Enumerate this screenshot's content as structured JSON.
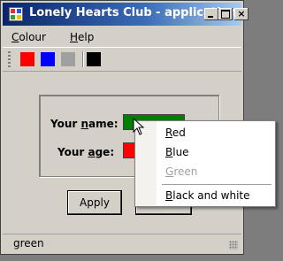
{
  "window": {
    "title": "Lonely Hearts Club - application",
    "buttons": [
      "minimize",
      "maximize",
      "close"
    ]
  },
  "menu": {
    "colour": {
      "first": "C",
      "rest": "olour"
    },
    "help": {
      "first": "H",
      "rest": "elp"
    }
  },
  "toolbar": {
    "swatches": [
      {
        "name": "red",
        "color": "#ff0000"
      },
      {
        "name": "blue",
        "color": "#0000ff"
      },
      {
        "name": "gray",
        "color": "#a0a0a0"
      },
      {
        "name": "black",
        "color": "#000000"
      }
    ]
  },
  "form": {
    "name_label": {
      "pre": "Your ",
      "ul": "n",
      "post": "ame:"
    },
    "age_label": {
      "pre": "Your ",
      "ul": "a",
      "post": "ge:"
    },
    "name_field_color": "#008000",
    "age_field_color": "#ff0000",
    "apply_label": "Apply"
  },
  "context_menu": {
    "red": {
      "ul": "R",
      "rest": "ed"
    },
    "blue": {
      "ul": "B",
      "rest": "lue"
    },
    "green": {
      "ul": "G",
      "rest": "reen"
    },
    "black_and_white": {
      "ul": "B",
      "rest": "lack and white"
    }
  },
  "status": {
    "text": "green"
  }
}
